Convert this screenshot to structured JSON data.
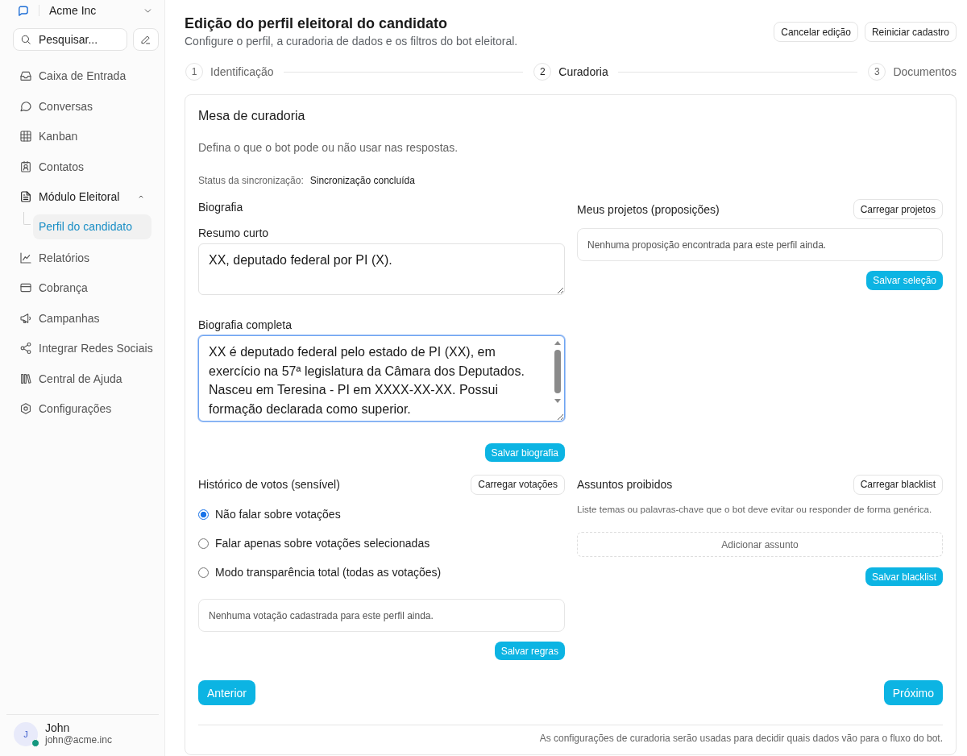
{
  "sidebar": {
    "workspace": "Acme Inc",
    "search": {
      "placeholder": "Pesquisar..."
    },
    "items": [
      {
        "label": "Caixa de Entrada",
        "selected": false
      },
      {
        "label": "Conversas",
        "selected": false
      },
      {
        "label": "Kanban",
        "selected": false
      },
      {
        "label": "Contatos",
        "selected": false
      },
      {
        "label": "Módulo Eleitoral",
        "selected": false,
        "expanded": true,
        "children": [
          {
            "label": "Perfil do candidato",
            "selected": true
          }
        ]
      },
      {
        "label": "Relatórios",
        "selected": false
      },
      {
        "label": "Cobrança",
        "selected": false
      },
      {
        "label": "Campanhas",
        "selected": false
      },
      {
        "label": "Integrar Redes Sociais",
        "selected": false
      },
      {
        "label": "Central de Ajuda",
        "selected": false
      },
      {
        "label": "Configurações",
        "selected": false
      }
    ],
    "user": {
      "initial": "J",
      "name": "John",
      "email": "john@acme.inc",
      "online": true
    }
  },
  "header": {
    "title": "Edição do perfil eleitoral do candidato",
    "subtitle": "Configure o perfil, a curadoria de dados e os filtros do bot eleitoral.",
    "buttons": [
      "Cancelar edição",
      "Reiniciar cadastro"
    ]
  },
  "steps": [
    {
      "number": "1",
      "label": "Identificação",
      "selected": false
    },
    {
      "number": "2",
      "label": "Curadoria",
      "selected": true
    },
    {
      "number": "3",
      "label": "Documentos",
      "selected": false
    }
  ],
  "card": {
    "title": "Mesa de curadoria",
    "description": "Defina o que o bot pode ou não usar nas respostas.",
    "sync": {
      "label": "Status da sincronização:",
      "value": "Sincronização concluída"
    },
    "biography": {
      "title": "Biografia",
      "fields": [
        {
          "label": "Resumo curto",
          "value": "XX, deputado federal por PI (X).",
          "focused": false
        },
        {
          "label": "Biografia completa",
          "value": "XX é deputado federal pelo estado de PI (XX), em exercício na 57ª legislatura da Câmara dos Deputados. Nasceu em Teresina - PI em XXXX-XX-XX. Possui formação declarada como superior.",
          "focused": true
        }
      ],
      "save_button": "Salvar biografia"
    },
    "projects": {
      "title": "Meus projetos (proposições)",
      "load_button": "Carregar projetos",
      "empty": "Nenhuma proposição encontrada para este perfil ainda.",
      "save_button": "Salvar seleção"
    },
    "votes": {
      "title": "Histórico de votos (sensível)",
      "load_button": "Carregar votações",
      "options": [
        {
          "label": "Não falar sobre votações",
          "selected": true
        },
        {
          "label": "Falar apenas sobre votações selecionadas",
          "selected": false
        },
        {
          "label": "Modo transparência total (todas as votações)",
          "selected": false
        }
      ],
      "empty": "Nenhuma votação cadastrada para este perfil ainda.",
      "save_button": "Salvar regras"
    },
    "topics": {
      "title": "Assuntos proibidos",
      "load_button": "Carregar blacklist",
      "hint": "Liste temas ou palavras-chave que o bot deve evitar ou responder de forma genérica.",
      "add_button": "Adicionar assunto",
      "save_button": "Salvar blacklist"
    },
    "nav": {
      "previous": "Anterior",
      "next": "Próximo"
    },
    "note": "As configurações de curadoria serão usadas para decidir quais dados vão para o fluxo do bot."
  }
}
